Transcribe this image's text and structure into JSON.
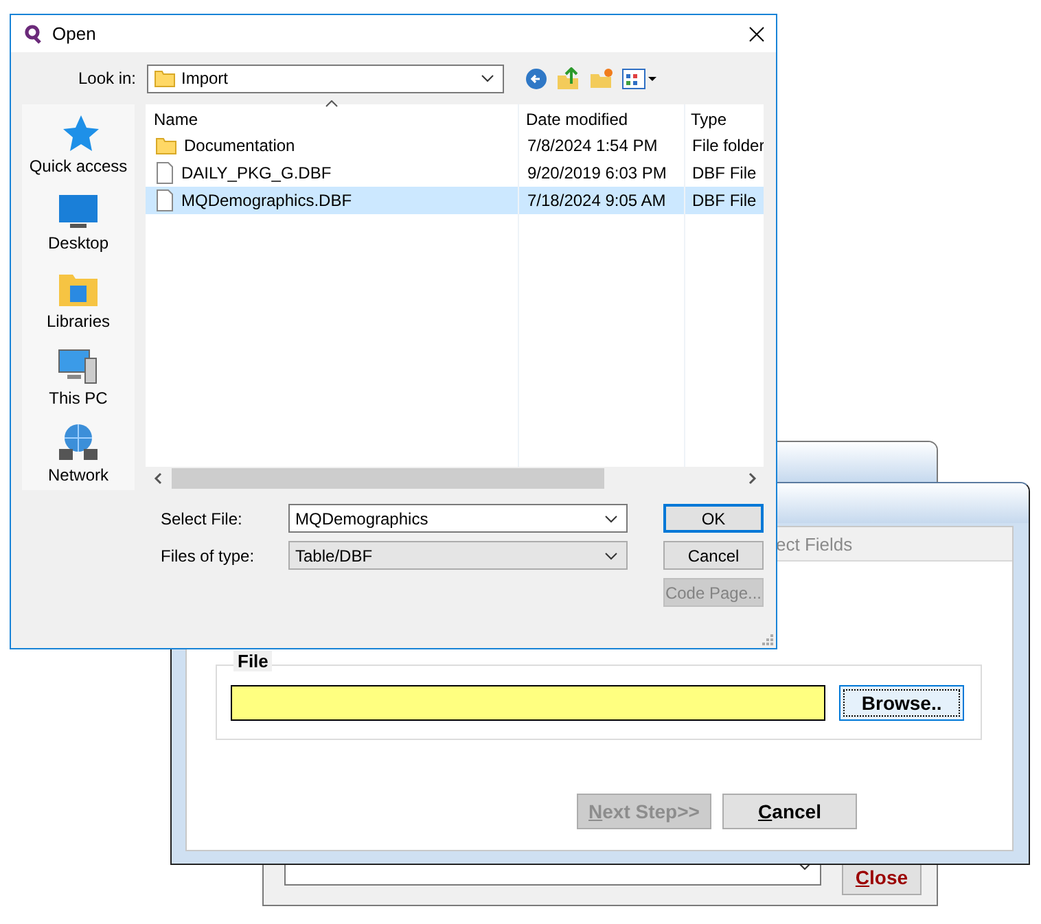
{
  "back_window": {
    "close_button": {
      "label": "Close",
      "first_letter_underlined": true
    }
  },
  "import_window": {
    "tab": "ect Fields",
    "file_label": "File",
    "browse_button": {
      "label": "Browse..",
      "focused": true
    },
    "buttons": [
      {
        "label": "Next Step>>",
        "first_letter_underlined": true,
        "disabled": true
      },
      {
        "label": "Cancel",
        "first_letter_underlined": true,
        "disabled": false
      }
    ]
  },
  "open_dialog": {
    "title": "Open",
    "look_in": {
      "label": "Look in:",
      "value": "Import"
    },
    "places": [
      {
        "label": "Quick access",
        "kind": "star"
      },
      {
        "label": "Desktop",
        "kind": "desktop"
      },
      {
        "label": "Libraries",
        "kind": "libraries"
      },
      {
        "label": "This PC",
        "kind": "pc"
      },
      {
        "label": "Network",
        "kind": "network"
      }
    ],
    "columns": [
      {
        "label": "Name",
        "sorted": true
      },
      {
        "label": "Date modified",
        "sorted": false
      },
      {
        "label": "Type",
        "sorted": false
      }
    ],
    "files": [
      {
        "kind": "folder",
        "name": "Documentation",
        "date": "7/8/2024 1:54 PM",
        "type": "File folder",
        "selected": false
      },
      {
        "kind": "file",
        "name": "DAILY_PKG_G.DBF",
        "date": "9/20/2019 6:03 PM",
        "type": "DBF File",
        "selected": false
      },
      {
        "kind": "file",
        "name": "MQDemographics.DBF",
        "date": "7/18/2024 9:05 AM",
        "type": "DBF File",
        "selected": true
      }
    ],
    "select_file": {
      "label": "Select File:",
      "value": "MQDemographics"
    },
    "file_type": {
      "label": "Files of type:",
      "value": "Table/DBF"
    },
    "buttons": [
      {
        "label": "OK",
        "default": true,
        "disabled": false
      },
      {
        "label": "Cancel",
        "default": false,
        "disabled": false
      },
      {
        "label": "Code Page...",
        "default": false,
        "disabled": true
      }
    ]
  }
}
